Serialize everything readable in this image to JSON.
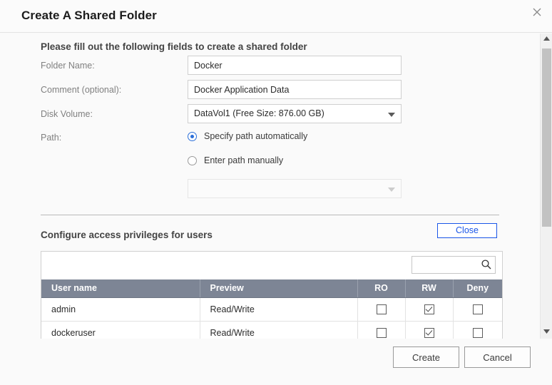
{
  "dialog": {
    "title": "Create A Shared Folder",
    "close_icon": "close-x-icon"
  },
  "form": {
    "intro": "Please fill out the following fields to create a shared folder",
    "fields": [
      {
        "label": "Folder Name:",
        "value": "Docker",
        "placeholder": ""
      },
      {
        "label": "Comment (optional):",
        "value": "Docker Application Data",
        "placeholder": ""
      },
      {
        "label": "Disk Volume:",
        "value": "DataVol1 (Free Size: 876.00 GB)"
      },
      {
        "label": "Path:"
      }
    ],
    "path_options": [
      {
        "label": "Specify path automatically",
        "selected": true
      },
      {
        "label": "Enter path manually",
        "selected": false
      }
    ],
    "manual_path_value": "",
    "manual_path_placeholder": ""
  },
  "privileges": {
    "section_title": "Configure access privileges for users",
    "close_label": "Close",
    "search_value": "",
    "search_placeholder": "",
    "search_icon": "search-icon",
    "columns": [
      "User name",
      "Preview",
      "RO",
      "RW",
      "Deny"
    ],
    "rows": [
      {
        "user": "admin",
        "preview": "Read/Write",
        "ro": false,
        "rw": true,
        "deny": false
      },
      {
        "user": "dockeruser",
        "preview": "Read/Write",
        "ro": false,
        "rw": true,
        "deny": false
      }
    ]
  },
  "footer": {
    "create_label": "Create",
    "cancel_label": "Cancel"
  },
  "colors": {
    "accent_blue": "#1a56e8",
    "radio_blue": "#2a6ed8",
    "table_header": "#7d8595",
    "preview_green": "#2e9e40"
  }
}
